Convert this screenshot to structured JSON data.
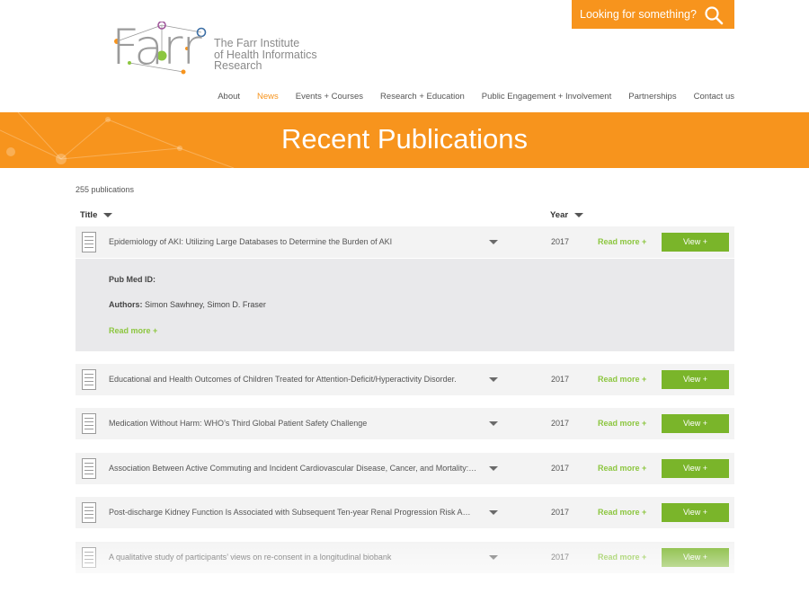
{
  "brand": {
    "logo_word": "Farr",
    "logo_lines": [
      "The Farr Institute",
      "of Health Informatics",
      "Research"
    ],
    "accent": "#f7941d",
    "green": "#8cc63f"
  },
  "search": {
    "label": "Looking for something?",
    "icon": "search-icon"
  },
  "nav": {
    "items": [
      {
        "label": "About"
      },
      {
        "label": "News"
      },
      {
        "label": "Events + Courses"
      },
      {
        "label": "Research + Education"
      },
      {
        "label": "Public Engagement + Involvement"
      },
      {
        "label": "Partnerships"
      },
      {
        "label": "Contact us"
      }
    ],
    "active": "News"
  },
  "banner": {
    "title": "Recent Publications"
  },
  "list": {
    "count": "255 publications",
    "headers": {
      "title": "Title",
      "year": "Year"
    },
    "rows": [
      {
        "title": "Epidemiology of AKI: Utilizing Large Databases to Determine the Burden of AKI",
        "year": "2017",
        "read_more": "Read more +",
        "view": "View +"
      },
      {
        "title": "Educational and Health Outcomes of Children Treated for Attention-Deficit/Hyperactivity Disorder.",
        "year": "2017",
        "read_more": "Read more +",
        "view": "View +"
      },
      {
        "title": "Medication Without Harm: WHO’s Third Global Patient Safety Challenge",
        "year": "2017",
        "read_more": "Read more +",
        "view": "View +"
      },
      {
        "title": "Association Between Active Commuting and Incident Cardiovascular Disease, Cancer, and Mortality: ...",
        "year": "2017",
        "read_more": "Read more +",
        "view": "View +"
      },
      {
        "title": "Post-discharge Kidney Function Is Associated with Subsequent Ten-year Renal Progression Risk Amon...",
        "year": "2017",
        "read_more": "Read more +",
        "view": "View +"
      },
      {
        "title": "A qualitative study of participants’ views on re-consent in a longitudinal biobank",
        "year": "2017",
        "read_more": "Read more +",
        "view": "View +"
      }
    ],
    "expanded": {
      "pubmed_label": "Pub Med ID:",
      "authors_label": "Authors:",
      "authors": "Simon Sawhney, Simon D. Fraser",
      "read_more": "Read more +"
    }
  }
}
